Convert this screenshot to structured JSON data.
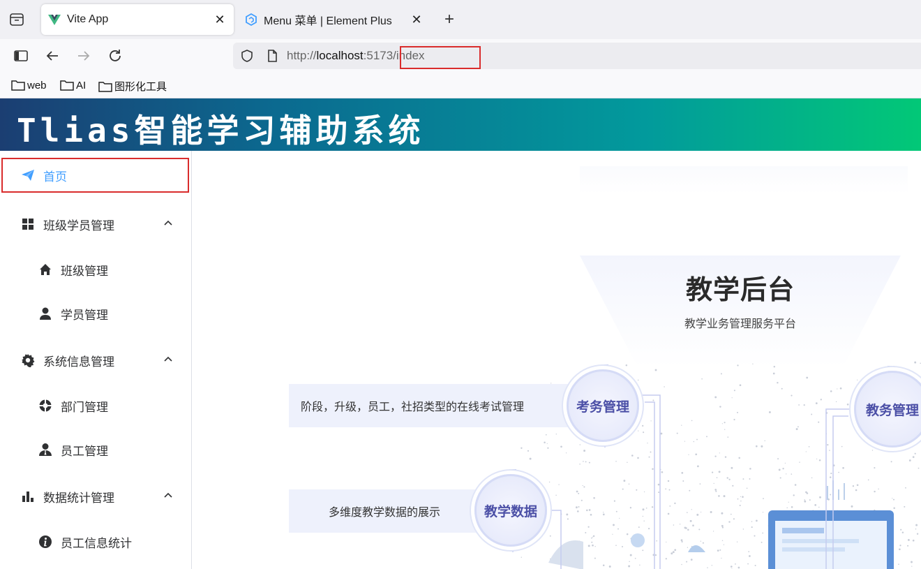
{
  "browser": {
    "tabs": [
      {
        "title": "Vite App",
        "active": true,
        "icon": "vue-logo-icon"
      },
      {
        "title": "Menu 菜单 | Element Plus",
        "active": false,
        "icon": "element-plus-icon"
      }
    ],
    "url": {
      "scheme": "http://",
      "host": "localhost",
      "rest": ":5173/index"
    },
    "bookmarks": [
      {
        "label": "web",
        "icon": "folder-icon"
      },
      {
        "label": "AI",
        "icon": "folder-icon"
      },
      {
        "label": "图形化工具",
        "icon": "folder-icon"
      }
    ]
  },
  "app": {
    "title": "Tlias智能学习辅助系统"
  },
  "sidebar": {
    "items": [
      {
        "label": "首页",
        "icon": "paper-plane-icon",
        "level": 1,
        "active": true
      },
      {
        "label": "班级学员管理",
        "icon": "grid-icon",
        "level": 1,
        "expanded": true
      },
      {
        "label": "班级管理",
        "icon": "home-icon",
        "level": 2
      },
      {
        "label": "学员管理",
        "icon": "user-icon",
        "level": 2
      },
      {
        "label": "系统信息管理",
        "icon": "gear-icon",
        "level": 1,
        "expanded": true
      },
      {
        "label": "部门管理",
        "icon": "lifebuoy-icon",
        "level": 2
      },
      {
        "label": "员工管理",
        "icon": "user-tie-icon",
        "level": 2
      },
      {
        "label": "数据统计管理",
        "icon": "bar-chart-icon",
        "level": 1,
        "expanded": true
      },
      {
        "label": "员工信息统计",
        "icon": "info-icon",
        "level": 2
      }
    ]
  },
  "hero": {
    "title": "教学后台",
    "subtitle": "教学业务管理服务平台",
    "features": [
      {
        "circle": "考务管理",
        "desc": "阶段，升级，员工，社招类型的在线考试管理"
      },
      {
        "circle": "教学数据",
        "desc": "多维度教学数据的展示"
      },
      {
        "circle": "教务管理",
        "desc": ""
      }
    ]
  },
  "colors": {
    "accent": "#409eff",
    "highlight_border": "#d92c2c",
    "header_gradient_start": "#1b3e72",
    "header_gradient_end": "#02c877"
  }
}
